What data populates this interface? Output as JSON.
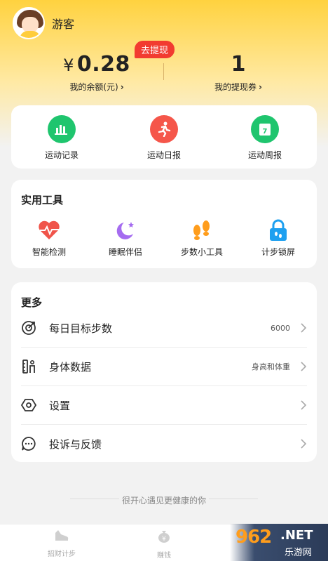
{
  "profile": {
    "username": "游客"
  },
  "wallet": {
    "currency": "¥",
    "balance": "0.28",
    "balance_label": "我的余额(元)",
    "withdraw_badge": "去提现",
    "coupon_count": "1",
    "coupon_label": "我的提现券"
  },
  "reports": [
    {
      "label": "运动记录",
      "icon": "bar-chart-icon",
      "color": "#1fc56e"
    },
    {
      "label": "运动日报",
      "icon": "runner-icon",
      "color": "#f5564a"
    },
    {
      "label": "运动周报",
      "icon": "calendar-7-icon",
      "color": "#1fc56e"
    }
  ],
  "tools": {
    "title": "实用工具",
    "items": [
      {
        "label": "智能检测",
        "icon": "heart-pulse-icon",
        "color": "#f0544a"
      },
      {
        "label": "睡眠伴侣",
        "icon": "moon-star-icon",
        "color": "#a56cf0"
      },
      {
        "label": "步数小工具",
        "icon": "footprints-icon",
        "color": "#ff9d1c"
      },
      {
        "label": "计步锁屏",
        "icon": "lock-icon",
        "color": "#1ea0f0"
      }
    ]
  },
  "more": {
    "title": "更多",
    "rows": [
      {
        "label": "每日目标步数",
        "value": "6000",
        "icon": "target-icon"
      },
      {
        "label": "身体数据",
        "value": "身高和体重",
        "icon": "body-data-icon"
      },
      {
        "label": "设置",
        "value": "",
        "icon": "hexagon-settings-icon"
      },
      {
        "label": "投诉与反馈",
        "value": "",
        "icon": "chat-bubble-icon"
      }
    ]
  },
  "footer_note": "很开心遇见更健康的你",
  "tabbar": {
    "tabs": [
      {
        "label": "招财计步",
        "icon": "shoe-icon"
      },
      {
        "label": "赚钱",
        "icon": "money-bag-icon"
      }
    ]
  },
  "watermark": {
    "number": "962",
    "suffix": ".NET",
    "sub": "乐游网"
  }
}
